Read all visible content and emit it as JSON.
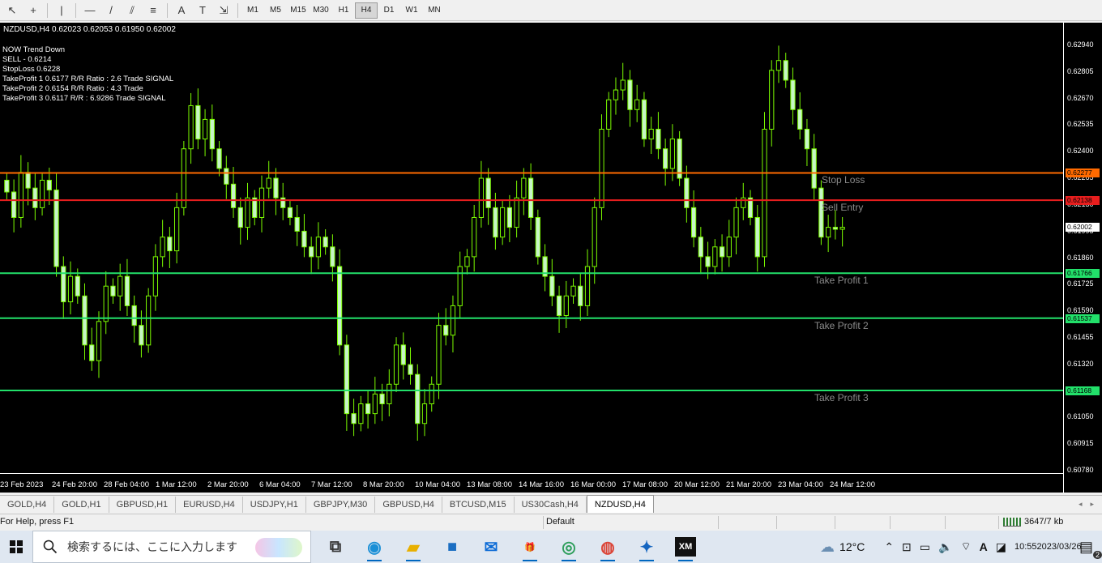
{
  "toolbar": {
    "tools": [
      {
        "name": "cursor-tool-icon",
        "glyph": "↖"
      },
      {
        "name": "crosshair-tool-icon",
        "glyph": "+"
      },
      {
        "name": "vertical-line-tool-icon",
        "glyph": "|"
      },
      {
        "name": "horizontal-line-tool-icon",
        "glyph": "—"
      },
      {
        "name": "trendline-tool-icon",
        "glyph": "/"
      },
      {
        "name": "channel-tool-icon",
        "glyph": "⫽"
      },
      {
        "name": "fibonacci-tool-icon",
        "glyph": "≡"
      },
      {
        "name": "text-tool-icon",
        "glyph": "A"
      },
      {
        "name": "text-label-tool-icon",
        "glyph": "T"
      },
      {
        "name": "arrows-tool-icon",
        "glyph": "⇲"
      }
    ],
    "timeframes": [
      "M1",
      "M5",
      "M15",
      "M30",
      "H1",
      "H4",
      "D1",
      "W1",
      "MN"
    ],
    "active_timeframe": "H4"
  },
  "chart": {
    "header": "NZDUSD,H4  0.62023 0.62053 0.61950 0.62002",
    "signal_lines": [
      "NOW Trend  Down",
      "SELL - 0.6214",
      "StopLoss 0.6228",
      "TakeProfit 1 0.6177 R/R Ratio : 2.6  Trade SIGNAL",
      "TakeProfit 2 0.6154 R/R Ratio : 4.3 Trade",
      "TakeProfit 3 0.6117 R/R : 6.9286 Trade SIGNAL"
    ],
    "price_ticks": [
      "0.62940",
      "0.62805",
      "0.62670",
      "0.62535",
      "0.62400",
      "0.62265",
      "0.62130",
      "0.61995",
      "0.61860",
      "0.61725",
      "0.61590",
      "0.61455",
      "0.61320",
      "0.61185",
      "0.61050",
      "0.60915",
      "0.60780"
    ],
    "current_price": "0.62002",
    "time_ticks": [
      "23 Feb 2023",
      "24 Feb 20:00",
      "28 Feb 04:00",
      "1 Mar 12:00",
      "2 Mar 20:00",
      "6 Mar 04:00",
      "7 Mar 12:00",
      "8 Mar 20:00",
      "10 Mar 04:00",
      "13 Mar 08:00",
      "14 Mar 16:00",
      "16 Mar 00:00",
      "17 Mar 08:00",
      "20 Mar 12:00",
      "21 Mar 20:00",
      "23 Mar 04:00",
      "24 Mar 12:00"
    ],
    "levels": [
      {
        "label": "Stop Loss",
        "price": 0.62277,
        "price_label": "0.62277",
        "color": "#ff6a00"
      },
      {
        "label": "Sell Entry",
        "price": 0.62138,
        "price_label": "0.62138",
        "color": "#e81e1e"
      },
      {
        "label": "Take Profit 1",
        "price": 0.61766,
        "price_label": "0.61766",
        "color": "#22e06a"
      },
      {
        "label": "Take Profit 2",
        "price": 0.61537,
        "price_label": "0.61537",
        "color": "#22e06a"
      },
      {
        "label": "Take Profit 3",
        "price": 0.61168,
        "price_label": "0.61168",
        "color": "#22e06a"
      }
    ],
    "colors": {
      "background": "#000000",
      "bull_candle": "#c7f5c7",
      "bear_candle": "#c7f5c7",
      "wick": "#7CFC00"
    }
  },
  "chart_data": {
    "type": "candlestick",
    "title": "NZDUSD,H4",
    "ylim": [
      0.6078,
      0.6301
    ],
    "closes": [
      0.6218,
      0.6205,
      0.6228,
      0.622,
      0.621,
      0.6224,
      0.6219,
      0.618,
      0.6162,
      0.6175,
      0.6165,
      0.614,
      0.6132,
      0.6152,
      0.617,
      0.6165,
      0.6175,
      0.616,
      0.615,
      0.614,
      0.6165,
      0.6185,
      0.6195,
      0.6188,
      0.621,
      0.624,
      0.6262,
      0.6245,
      0.6255,
      0.624,
      0.623,
      0.6222,
      0.621,
      0.62,
      0.6215,
      0.6205,
      0.622,
      0.6225,
      0.6215,
      0.621,
      0.6205,
      0.6198,
      0.619,
      0.6185,
      0.6195,
      0.619,
      0.618,
      0.614,
      0.6105,
      0.61,
      0.611,
      0.6105,
      0.6115,
      0.611,
      0.612,
      0.614,
      0.613,
      0.6125,
      0.61,
      0.611,
      0.612,
      0.615,
      0.6145,
      0.616,
      0.618,
      0.6185,
      0.6205,
      0.6225,
      0.621,
      0.6195,
      0.621,
      0.62,
      0.6215,
      0.6225,
      0.6205,
      0.6185,
      0.6175,
      0.6165,
      0.6155,
      0.6165,
      0.617,
      0.616,
      0.618,
      0.621,
      0.625,
      0.6265,
      0.627,
      0.6275,
      0.626,
      0.6265,
      0.6245,
      0.625,
      0.624,
      0.623,
      0.6245,
      0.6225,
      0.621,
      0.6195,
      0.6185,
      0.618,
      0.619,
      0.6185,
      0.6195,
      0.621,
      0.6215,
      0.6205,
      0.6185,
      0.625,
      0.628,
      0.6285,
      0.6275,
      0.626,
      0.625,
      0.624,
      0.622,
      0.6195,
      0.62,
      0.6199,
      0.62
    ]
  },
  "tabs": [
    "GOLD,H4",
    "GOLD,H1",
    "GBPUSD,H1",
    "EURUSD,H4",
    "USDJPY,H1",
    "GBPJPY,M30",
    "GBPUSD,H4",
    "BTCUSD,M15",
    "US30Cash,H4",
    "NZDUSD,H4"
  ],
  "active_tab": "NZDUSD,H4",
  "tab_nav": [
    "◂",
    "▸"
  ],
  "statusbar": {
    "help": "For Help, press F1",
    "profile": "Default",
    "connection": "3647/7 kb"
  },
  "taskbar": {
    "search_placeholder": "検索するには、ここに入力します",
    "weather": "12°C",
    "time": "10:55",
    "date": "2023/03/26",
    "ime": "A",
    "notification_count": "2",
    "apps": [
      {
        "name": "task-view-icon",
        "glyph": "⧉",
        "color": "#333"
      },
      {
        "name": "edge-icon",
        "glyph": "◉",
        "color": "#1a8fd6"
      },
      {
        "name": "file-explorer-icon",
        "glyph": "▰",
        "color": "#e8b000"
      },
      {
        "name": "store-icon",
        "glyph": "■",
        "color": "#1b6ec2"
      },
      {
        "name": "mail-icon",
        "glyph": "✉",
        "color": "#0c6bd6"
      },
      {
        "name": "gift-app-icon",
        "glyph": "🎁",
        "color": "#d62828"
      },
      {
        "name": "edge-dev-icon",
        "glyph": "◎",
        "color": "#2e9e5b"
      },
      {
        "name": "chrome-icon",
        "glyph": "◍",
        "color": "#db4437"
      },
      {
        "name": "vpn-app-icon",
        "glyph": "✦",
        "color": "#1565c0"
      },
      {
        "name": "xm-trading-icon",
        "glyph": "XM",
        "color": "#ffffff",
        "bg": "#111111"
      }
    ]
  }
}
